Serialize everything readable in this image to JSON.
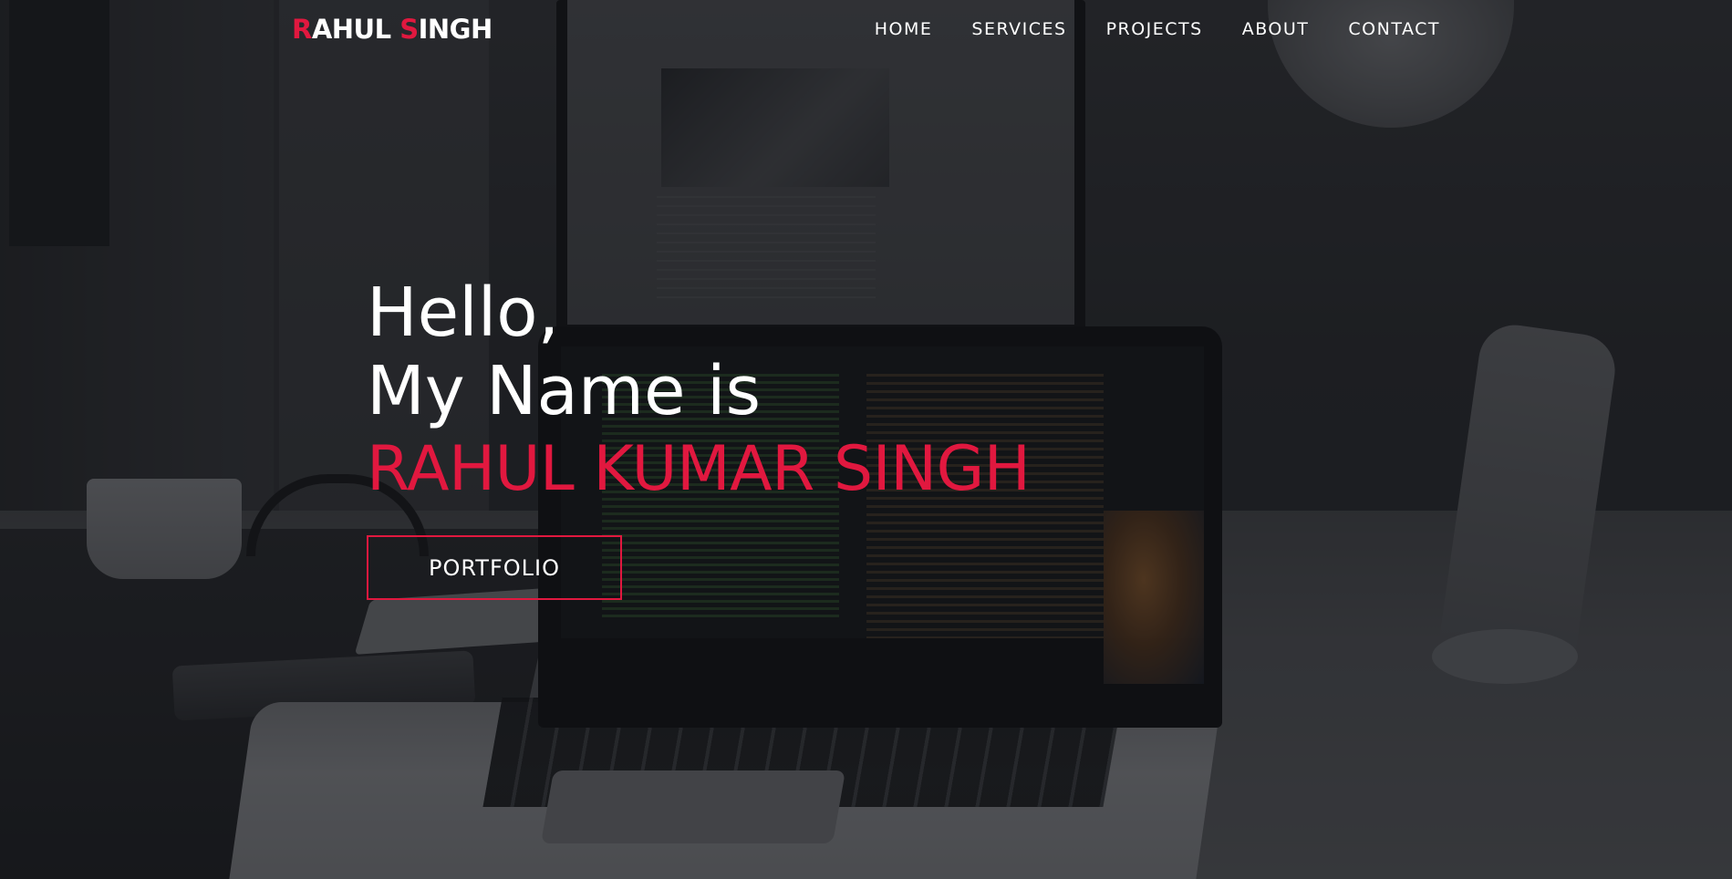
{
  "brand": {
    "logo_initial_1": "R",
    "logo_rest_1": "AHUL",
    "logo_initial_2": "S",
    "logo_rest_2": "INGH",
    "accent_color": "#e1183f"
  },
  "nav": {
    "items": [
      {
        "label": "HOME"
      },
      {
        "label": "SERVICES"
      },
      {
        "label": "PROJECTS"
      },
      {
        "label": "ABOUT"
      },
      {
        "label": "CONTACT"
      }
    ]
  },
  "hero": {
    "greeting": "Hello,",
    "intro": "My Name is",
    "name": "RAHUL KUMAR SINGH",
    "cta_label": "PORTFOLIO",
    "background_image": "dark-tinted photo of a workspace desk with a laptop showing code, a monitor, mug, headphones, phone, and speaker"
  }
}
